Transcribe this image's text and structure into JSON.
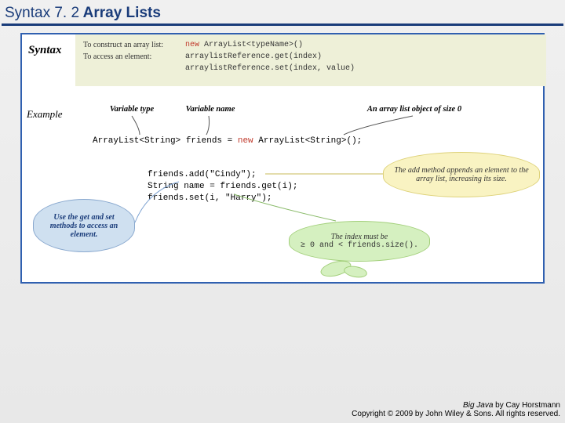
{
  "title": {
    "prefix": "Syntax 7. 2",
    "main": " Array Lists"
  },
  "syntax_label": "Syntax",
  "example_label": "Example",
  "syntax_rows": [
    {
      "lbl": "To construct an array list:",
      "prefix": "new ",
      "code": "ArrayList<typeName>()"
    },
    {
      "lbl": "To access an element:",
      "code": "arraylistReference.get(index)"
    },
    {
      "lbl": "",
      "code": "arraylistReference.set(index, value)"
    }
  ],
  "annotations": {
    "vartype": "Variable type",
    "varname": "Variable name",
    "objsize0": "An array list object of size 0"
  },
  "decl_line": "ArrayList<String> friends = new ArrayList<String>();",
  "code_block": "friends.add(\"Cindy\");\nString name = friends.get(i);\nfriends.set(i, \"Harry\");",
  "memos": {
    "blue": "Use the\nget and set methods\nto access an element.",
    "yellow": "The add method\nappends an element to the array list,\nincreasing its size.",
    "green_prefix": "The index must be",
    "green_code": "≥ 0 and < friends.size()."
  },
  "footer": {
    "book": "Big Java",
    "by": " by Cay Horstmann",
    "copyright": "Copyright © 2009 by John Wiley & Sons. All rights reserved."
  }
}
